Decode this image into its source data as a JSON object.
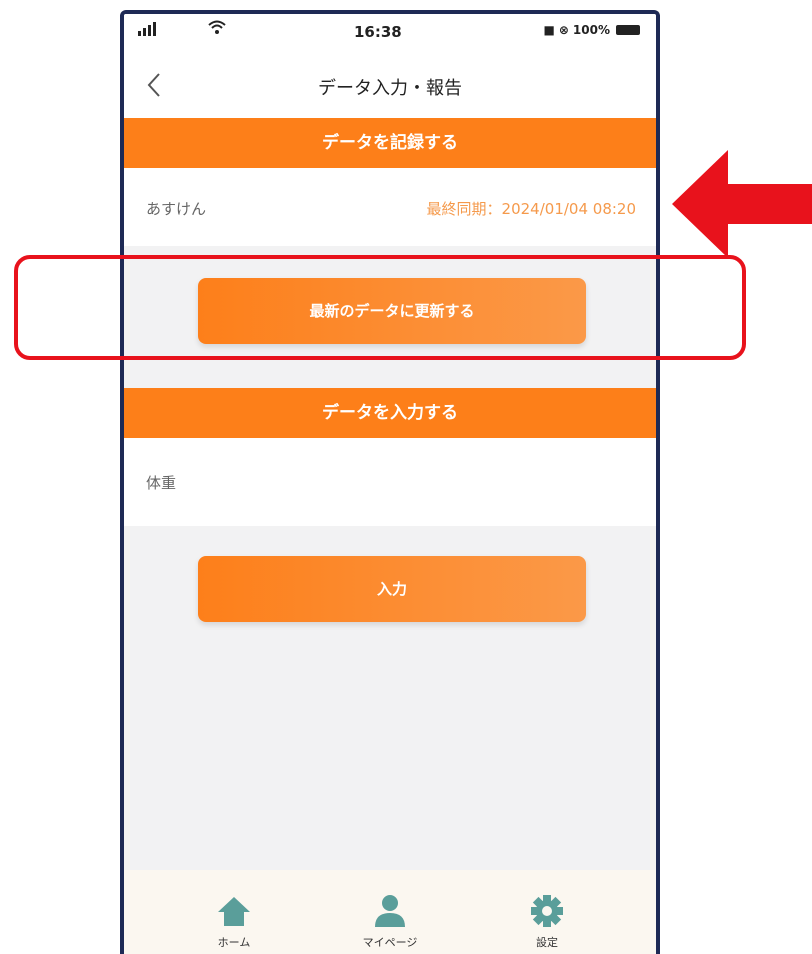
{
  "status": {
    "time": "16:38",
    "battery_text": "100%"
  },
  "nav": {
    "title": "データ入力・報告"
  },
  "record_section": {
    "header": "データを記録する",
    "row_label": "あすけん",
    "sync_text": "最終同期：2024/01/04 08:20",
    "update_button": "最新のデータに更新する"
  },
  "input_section": {
    "header": "データを入力する",
    "row_label": "体重",
    "input_button": "入力"
  },
  "tabs": [
    {
      "label": "ホーム",
      "icon": "home-icon"
    },
    {
      "label": "マイページ",
      "icon": "person-icon"
    },
    {
      "label": "設定",
      "icon": "gear-icon"
    }
  ],
  "colors": {
    "accent": "#fd7f19",
    "sync_text": "#f59a4c",
    "tab_icon": "#5a9e9a",
    "annotation": "#e8121c",
    "frame": "#1e2a55"
  }
}
